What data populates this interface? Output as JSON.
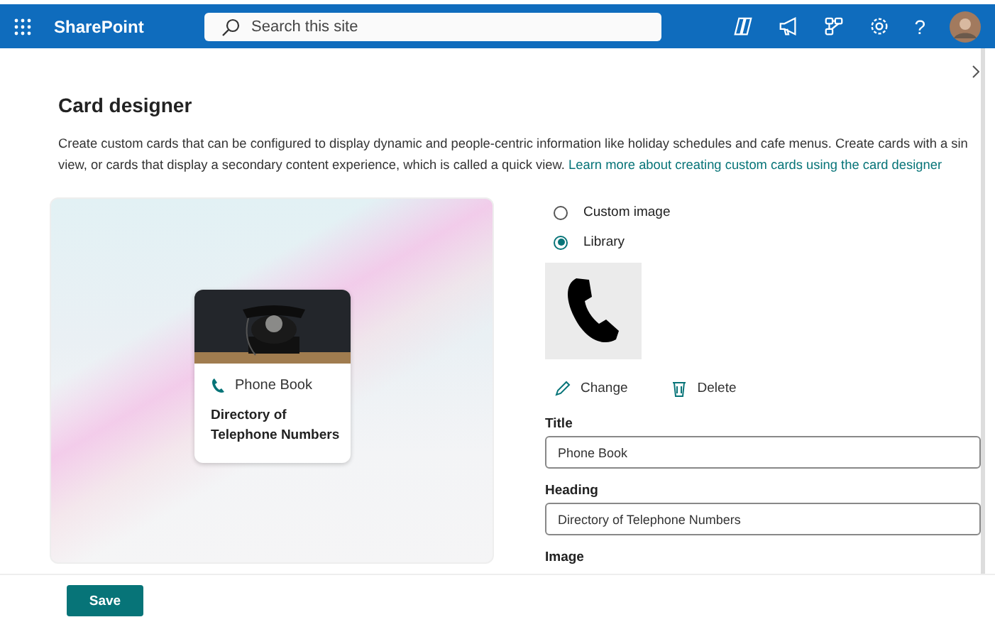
{
  "header": {
    "app_name": "SharePoint",
    "search": {
      "placeholder": "Search this site"
    },
    "help": "?"
  },
  "page": {
    "title": "Card designer",
    "description": [
      "Create custom cards that can be configured to display dynamic and people-centric information like holiday schedules and cafe menus. Create cards with a sin",
      "view, or cards that display a secondary content experience, which is called a quick view."
    ],
    "link": "Learn more about creating custom cards using the card designer"
  },
  "preview": {
    "card_title": "Phone Book",
    "card_heading": [
      "Directory of",
      "Telephone Numbers"
    ]
  },
  "image_source": [
    {
      "label": "Custom image",
      "selected": false
    },
    {
      "label": "Library",
      "selected": true
    }
  ],
  "image_actions": [
    {
      "kind": "change",
      "label": "Change"
    },
    {
      "kind": "delete",
      "label": "Delete"
    }
  ],
  "fields": [
    {
      "label": "Title",
      "value": "Phone Book"
    },
    {
      "label": "Heading",
      "value": "Directory of Telephone Numbers"
    }
  ],
  "image_label": "Image",
  "save": "Save"
}
